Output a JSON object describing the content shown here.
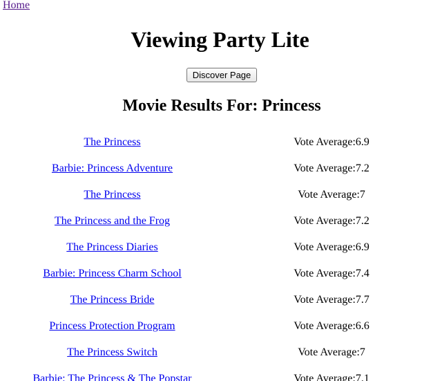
{
  "nav": {
    "home_label": "Home"
  },
  "header": {
    "title": "Viewing Party Lite",
    "discover_label": "Discover Page"
  },
  "results": {
    "heading": "Movie Results For: Princess",
    "vote_prefix": "Vote Average:",
    "movies": [
      {
        "title": "The Princess",
        "vote": "6.9"
      },
      {
        "title": "Barbie: Princess Adventure",
        "vote": "7.2"
      },
      {
        "title": "The Princess",
        "vote": "7"
      },
      {
        "title": "The Princess and the Frog",
        "vote": "7.2"
      },
      {
        "title": "The Princess Diaries",
        "vote": "6.9"
      },
      {
        "title": "Barbie: Princess Charm School",
        "vote": "7.4"
      },
      {
        "title": "The Princess Bride",
        "vote": "7.7"
      },
      {
        "title": "Princess Protection Program",
        "vote": "6.6"
      },
      {
        "title": "The Princess Switch",
        "vote": "7"
      },
      {
        "title": "Barbie: The Princess & The Popstar",
        "vote": "7.1"
      }
    ]
  }
}
